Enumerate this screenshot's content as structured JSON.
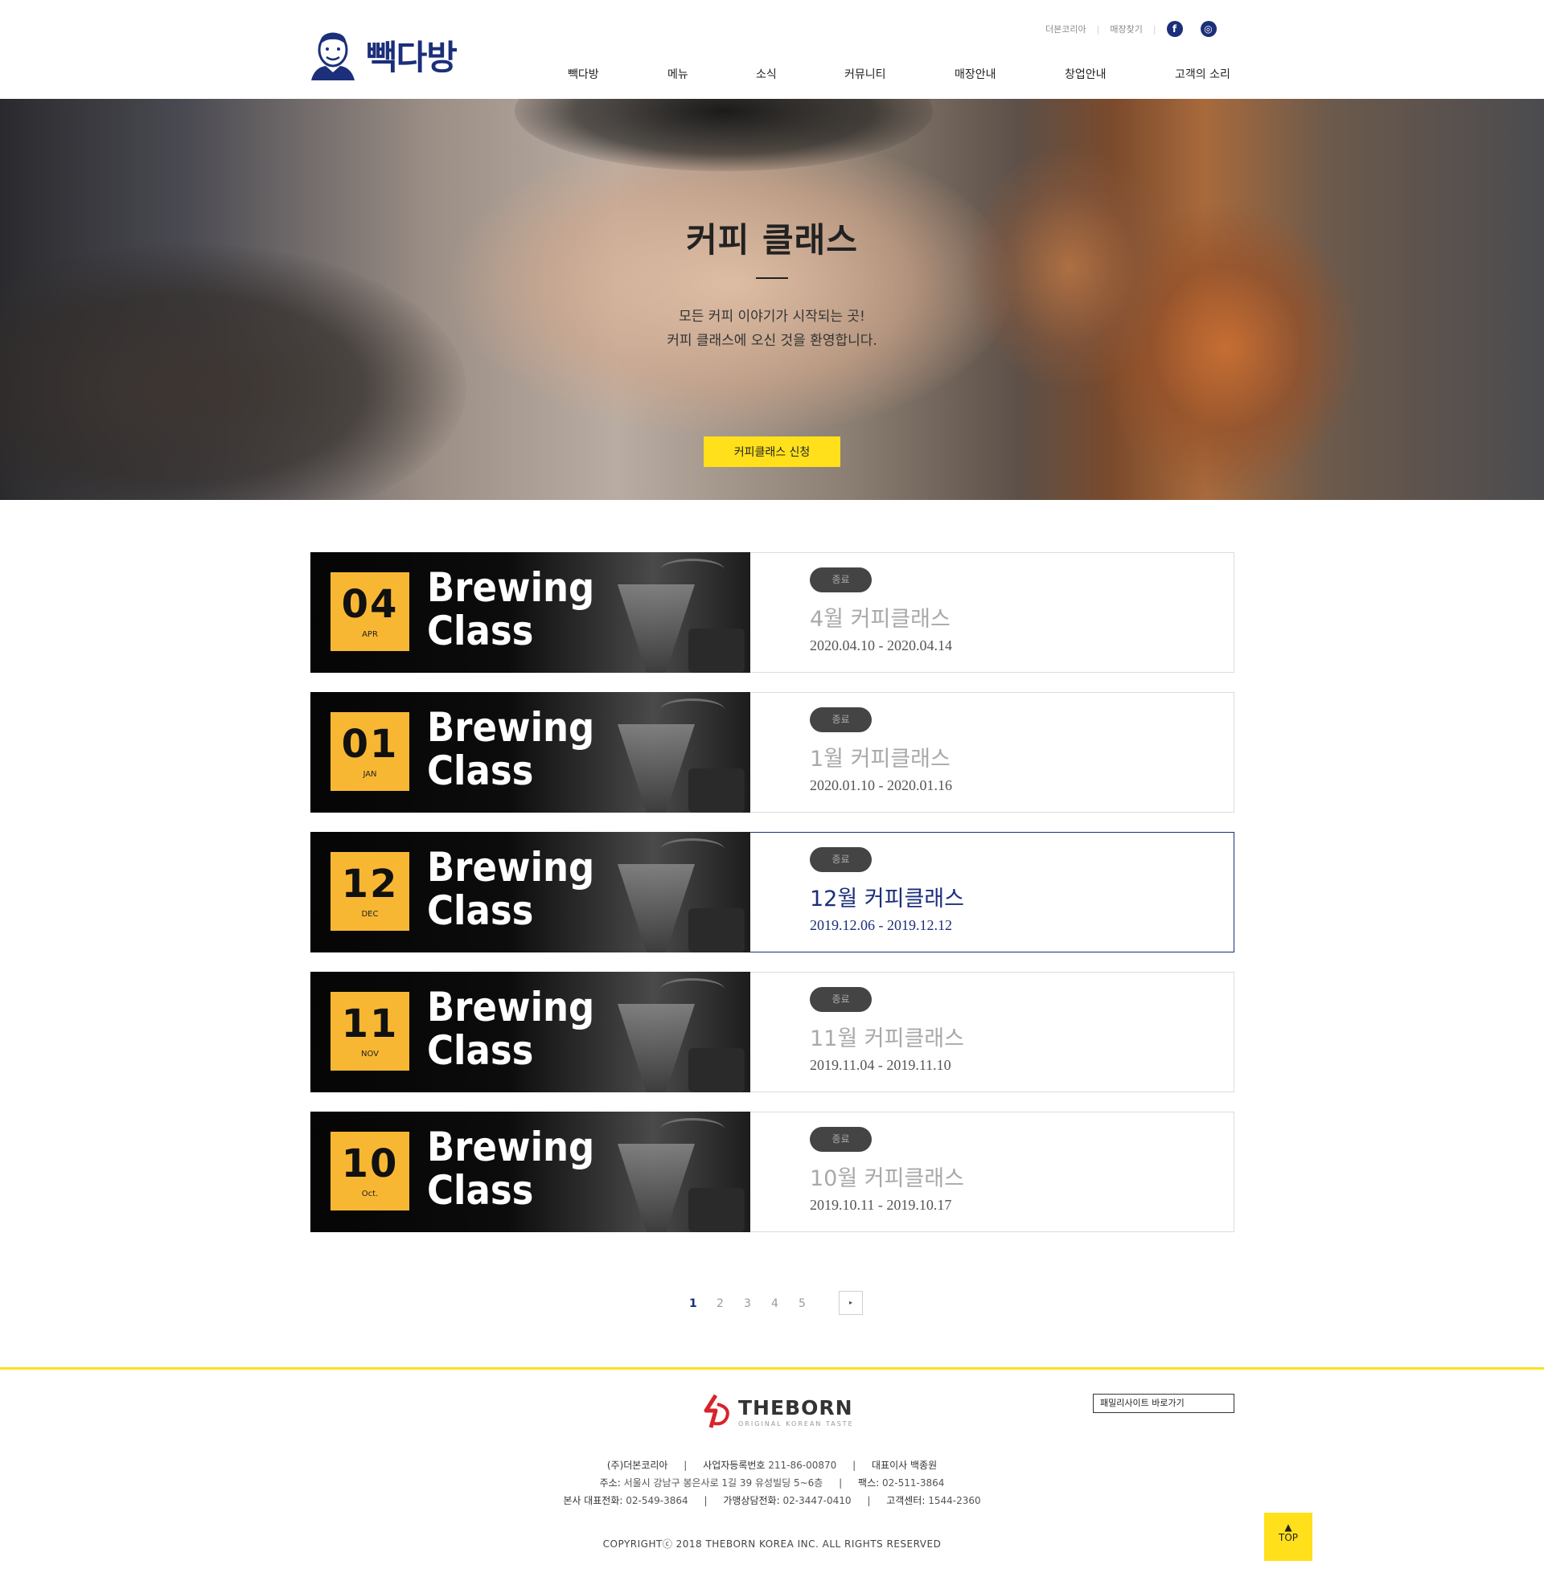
{
  "header": {
    "logo_text": "빽다방",
    "util_links": [
      "더본코리아",
      "매장찾기"
    ],
    "sns": [
      {
        "name": "facebook",
        "glyph": "f"
      },
      {
        "name": "instagram",
        "glyph": "◎"
      }
    ],
    "nav": [
      "빽다방",
      "메뉴",
      "소식",
      "커뮤니티",
      "매장안내",
      "창업안내",
      "고객의 소리"
    ]
  },
  "hero": {
    "title": "커피 클래스",
    "subtitle_line1": "모든 커피 이야기가 시작되는 곳!",
    "subtitle_line2": "커피 클래스에 오신 것을 환영합니다.",
    "button_label": "커피클래스 신청"
  },
  "classes": [
    {
      "num": "04",
      "month": "APR",
      "thumb_line1": "Brewing",
      "thumb_line2": "Class",
      "badge": "종료",
      "title": "4월 커피클래스",
      "date": "2020.04.10 - 2020.04.14",
      "active": false
    },
    {
      "num": "01",
      "month": "JAN",
      "thumb_line1": "Brewing",
      "thumb_line2": "Class",
      "badge": "종료",
      "title": "1월 커피클래스",
      "date": "2020.01.10 - 2020.01.16",
      "active": false
    },
    {
      "num": "12",
      "month": "DEC",
      "thumb_line1": "Brewing",
      "thumb_line2": "Class",
      "badge": "종료",
      "title": "12월 커피클래스",
      "date": "2019.12.06 - 2019.12.12",
      "active": true
    },
    {
      "num": "11",
      "month": "NOV",
      "thumb_line1": "Brewing",
      "thumb_line2": "Class",
      "badge": "종료",
      "title": "11월 커피클래스",
      "date": "2019.11.04 - 2019.11.10",
      "active": false
    },
    {
      "num": "10",
      "month": "Oct.",
      "thumb_line1": "Brewing",
      "thumb_line2": "Class",
      "badge": "종료",
      "title": "10월 커피클래스",
      "date": "2019.10.11 - 2019.10.17",
      "active": false
    }
  ],
  "pagination": {
    "pages": [
      "1",
      "2",
      "3",
      "4",
      "5"
    ],
    "current": "1",
    "next_glyph": "▸"
  },
  "footer": {
    "brand_name": "THEBORN",
    "brand_tagline": "ORIGINAL KOREAN TASTE",
    "family_site_label": "패밀리사이트 바로가기",
    "company": "(주)더본코리아",
    "bizno_label": "사업자등록번호",
    "bizno": "211-86-00870",
    "ceo_label": "대표이사",
    "ceo": "백종원",
    "address_label": "주소:",
    "address": "서울시 강남구 봉은사로 1길 39 유성빌딩 5~6층",
    "fax_label": "팩스:",
    "fax": "02-511-3864",
    "hq_tel_label": "본사 대표전화:",
    "hq_tel": "02-549-3864",
    "franchise_tel_label": "가맹상담전화:",
    "franchise_tel": "02-3447-0410",
    "cs_label": "고객센터:",
    "cs_tel": "1544-2360",
    "copyright": "COPYRIGHTⓒ 2018 THEBORN KOREA INC. ALL RIGHTS RESERVED"
  },
  "top_button": {
    "arrow": "▲",
    "label": "TOP"
  },
  "colors": {
    "brand_navy": "#1b2f7a",
    "accent_yellow": "#ffe01b",
    "date_box": "#f8b733"
  }
}
